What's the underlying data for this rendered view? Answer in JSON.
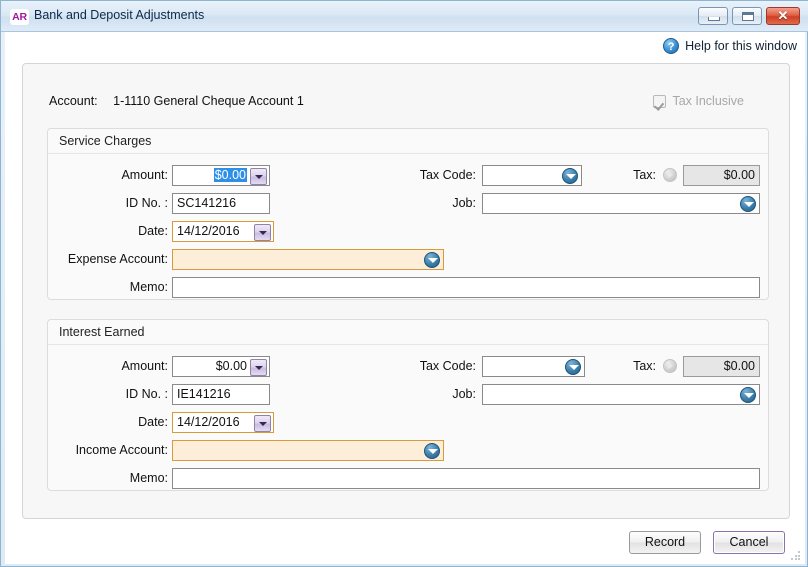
{
  "window": {
    "app_badge": "AR",
    "title": "Bank and Deposit Adjustments",
    "buttons": {
      "minimize": "minimize-button",
      "maximize": "restore-button",
      "close": "✕"
    }
  },
  "help": {
    "icon": "question-mark-icon",
    "label": "Help for this window"
  },
  "header": {
    "account_label": "Account:",
    "account_value": "1-1110 General Cheque Account 1",
    "tax_inclusive_label": "Tax Inclusive",
    "tax_inclusive_checked": true,
    "tax_inclusive_enabled": false
  },
  "groups": [
    {
      "title": "Service Charges",
      "amount_label": "Amount:",
      "amount_value": "$0.00",
      "amount_selected": true,
      "id_label": "ID No. :",
      "id_value": "SC141216",
      "date_label": "Date:",
      "date_value": "14/12/2016",
      "account_label": "Expense Account:",
      "account_value": "",
      "memo_label": "Memo:",
      "memo_value": "",
      "tax_code_label": "Tax Code:",
      "tax_code_value": "",
      "tax_label": "Tax:",
      "tax_value": "$0.00",
      "job_label": "Job:",
      "job_value": ""
    },
    {
      "title": "Interest Earned",
      "amount_label": "Amount:",
      "amount_value": "$0.00",
      "amount_selected": false,
      "id_label": "ID No. :",
      "id_value": "IE141216",
      "date_label": "Date:",
      "date_value": "14/12/2016",
      "account_label": "Income Account:",
      "account_value": "",
      "memo_label": "Memo:",
      "memo_value": "",
      "tax_code_label": "Tax Code:",
      "tax_code_value": "",
      "tax_label": "Tax:",
      "tax_value": "$0.00",
      "job_label": "Job:",
      "job_value": ""
    }
  ],
  "footer": {
    "record_label": "Record",
    "cancel_label": "Cancel"
  },
  "colors": {
    "required_field_fill": "#fdeeda",
    "required_field_border": "#d89a3a",
    "selection_highlight": "#2f8fe8",
    "accent_blue": "#3c7fab",
    "brand_purple": "#a0189c",
    "close_red": "#cf3f24",
    "default_button_border": "#8a74ae"
  }
}
